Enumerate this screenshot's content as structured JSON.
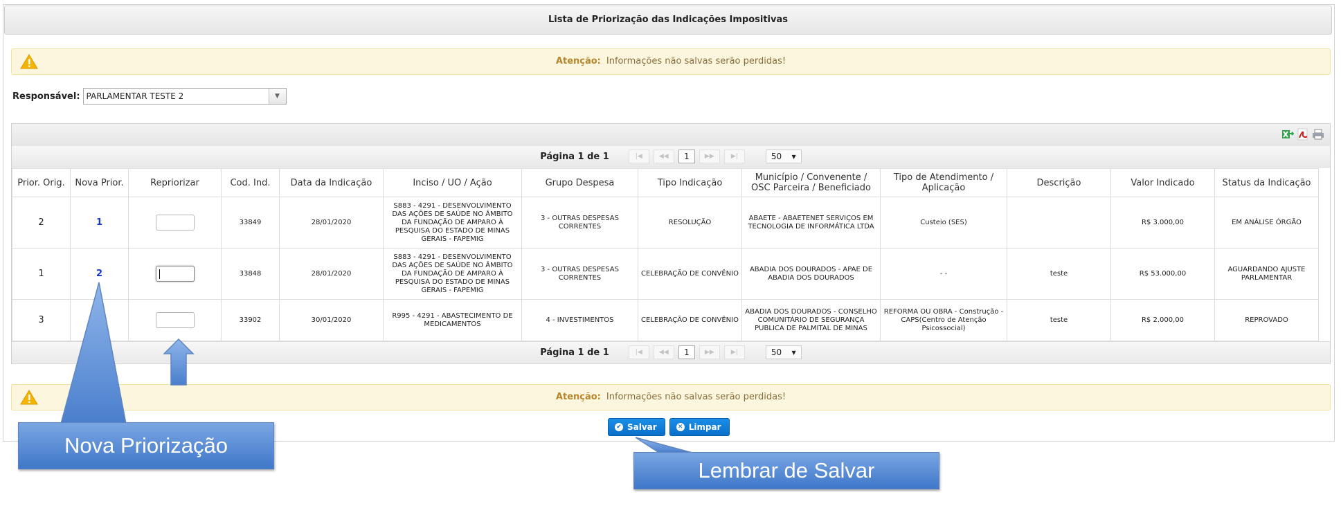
{
  "panel": {
    "title": "Lista de Priorização das Indicações Impositivas"
  },
  "warning": {
    "label": "Atenção:",
    "message": "Informações não salvas serão perdidas!"
  },
  "responsavel": {
    "label": "Responsável:",
    "value": "PARLAMENTAR TESTE 2"
  },
  "pager": {
    "text": "Página 1 de 1",
    "page": "1",
    "page_size": "50"
  },
  "columns": [
    "Prior. Orig.",
    "Nova Prior.",
    "Repriorizar",
    "Cod. Ind.",
    "Data da Indicação",
    "Inciso / UO / Ação",
    "Grupo Despesa",
    "Tipo Indicação",
    "Município / Convenente / OSC Parceira / Beneficiado",
    "Tipo de Atendimento / Aplicação",
    "Descrição",
    "Valor Indicado",
    "Status da Indicação"
  ],
  "rows": [
    {
      "prior_orig": "2",
      "nova_prior": "1",
      "cod": "33849",
      "data": "28/01/2020",
      "inciso": "S883 - 4291 - DESENVOLVIMENTO DAS AÇÕES DE SAÚDE NO ÂMBITO DA FUNDAÇÃO DE AMPARO À PESQUISA DO ESTADO DE MINAS GERAIS - FAPEMIG",
      "grupo": "3 - OUTRAS DESPESAS CORRENTES",
      "tipo": "RESOLUÇÃO",
      "municipio": "ABAETE - ABAETENET SERVIÇOS EM TECNOLOGIA DE INFORMÁTICA LTDA",
      "atendimento": "Custeio (SES)",
      "descricao": "",
      "valor": "R$ 3.000,00",
      "status": "EM ANÁLISE ÓRGÃO"
    },
    {
      "prior_orig": "1",
      "nova_prior": "2",
      "cod": "33848",
      "data": "28/01/2020",
      "inciso": "S883 - 4291 - DESENVOLVIMENTO DAS AÇÕES DE SAÚDE NO ÂMBITO DA FUNDAÇÃO DE AMPARO À PESQUISA DO ESTADO DE MINAS GERAIS - FAPEMIG",
      "grupo": "3 - OUTRAS DESPESAS CORRENTES",
      "tipo": "CELEBRAÇÃO DE CONVÊNIO",
      "municipio": "ABADIA DOS DOURADOS - APAE DE ABADIA DOS DOURADOS",
      "atendimento": "- -",
      "descricao": "teste",
      "valor": "R$ 53.000,00",
      "status": "AGUARDANDO AJUSTE PARLAMENTAR"
    },
    {
      "prior_orig": "3",
      "nova_prior": "",
      "cod": "33902",
      "data": "30/01/2020",
      "inciso": "R995 - 4291 - ABASTECIMENTO DE MEDICAMENTOS",
      "grupo": "4 - INVESTIMENTOS",
      "tipo": "CELEBRAÇÃO DE CONVÊNIO",
      "municipio": "ABADIA DOS DOURADOS - CONSELHO COMUNITÁRIO DE SEGURANÇA PUBLICA DE PALMITAL DE MINAS",
      "atendimento": "REFORMA OU OBRA - Construção - CAPS(Centro de Atenção Psicossocial)",
      "descricao": "teste",
      "valor": "R$ 2.000,00",
      "status": "REPROVADO"
    }
  ],
  "buttons": {
    "save": "Salvar",
    "clear": "Limpar"
  },
  "callouts": {
    "nova": "Nova Priorização",
    "salvar": "Lembrar de Salvar"
  },
  "colors": {
    "accent": "#0a6fc9",
    "callout": "#4f86d6",
    "link": "#1535c8",
    "warning_bg": "#fbf6dd"
  },
  "icons": [
    "warning-icon",
    "excel-export-icon",
    "pdf-export-icon",
    "print-icon",
    "check-icon",
    "clear-icon"
  ]
}
